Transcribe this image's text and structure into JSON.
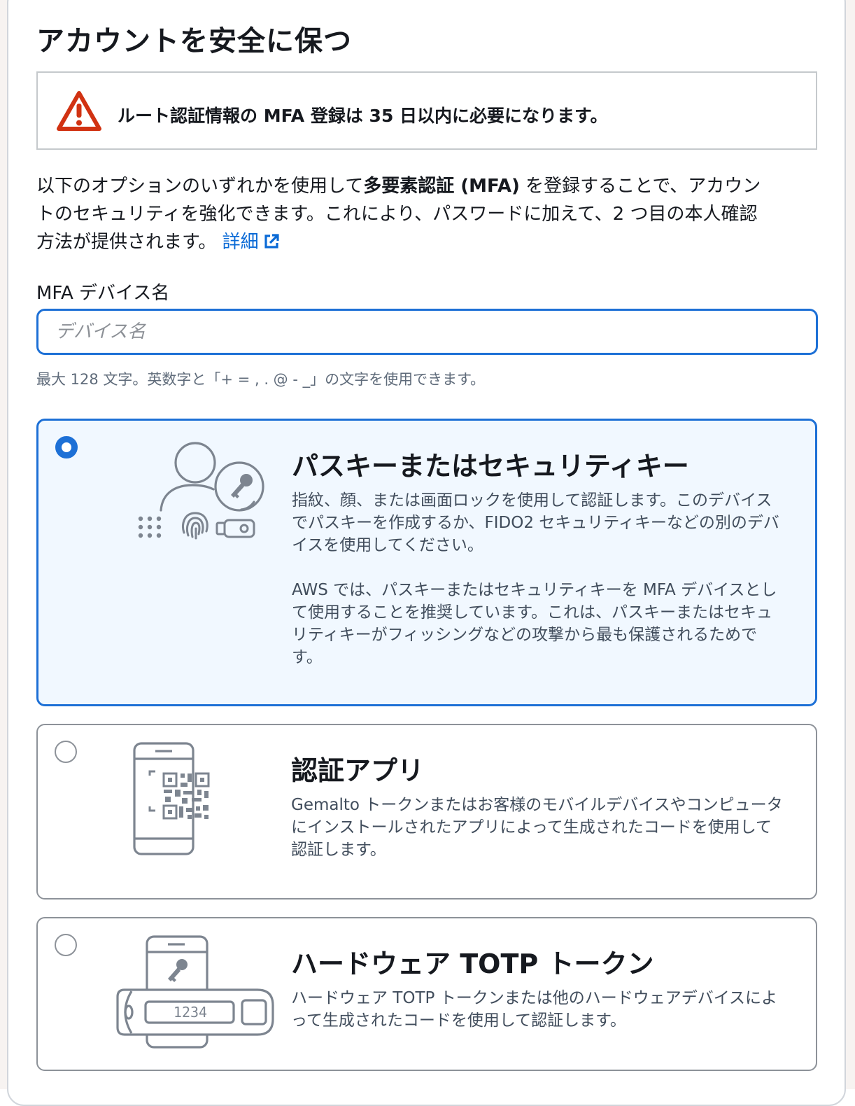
{
  "page": {
    "title": "アカウントを安全に保つ"
  },
  "alert": {
    "icon": "warning-triangle-icon",
    "text": "ルート認証情報の MFA 登録は 35 日以内に必要になります。",
    "color": "#d13212"
  },
  "intro": {
    "line1_pre": "以下のオプションのいずれかを使用して",
    "line1_bold": "多要素認証 (MFA)",
    "line1_post": " を登録することで、アカウン",
    "line2": "トのセキュリティを強化できます。これにより、パスワードに加えて、2 つ目の本人確認",
    "line3": "方法が提供されます。",
    "link_label": "詳細",
    "link_icon": "external-link-icon"
  },
  "mfa_field": {
    "label": "MFA デバイス名",
    "value": "",
    "placeholder": "デバイス名",
    "hint": "最大 128 文字。英数字と「+ = , . @ - _」の文字を使用できます。"
  },
  "options": [
    {
      "selected": true,
      "icon": "passkey-security-key-icon",
      "title": "パスキーまたはセキュリティキー",
      "desc1": [
        "指紋、顔、または画面ロックを使用して認証します。このデバイス",
        "でパスキーを作成するか、FIDO2 セキュリティキーなどの別のデバ",
        "イスを使用してください。"
      ],
      "desc2": [
        "AWS では、パスキーまたはセキュリティキーを MFA デバイスとし",
        "て使用することを推奨しています。これは、パスキーまたはセキュ",
        "リティキーがフィッシングなどの攻撃から最も保護されるためで",
        "す。"
      ]
    },
    {
      "selected": false,
      "icon": "authenticator-app-qr-icon",
      "title": "認証アプリ",
      "desc1": [
        "Gemalto トークンまたはお客様のモバイルデバイスやコンピュータ",
        "にインストールされたアプリによって生成されたコードを使用して",
        "認証します。"
      ]
    },
    {
      "selected": false,
      "icon": "hardware-totp-token-icon",
      "title": "ハードウェア TOTP トークン",
      "token_digits": "1234",
      "desc1": [
        "ハードウェア TOTP トークンまたは他のハードウェアデバイスによ",
        "って生成されたコードを使用して認証します。"
      ]
    }
  ],
  "colors": {
    "accent": "#1d70d6",
    "selected_bg": "#f1f8ff",
    "link": "#0a6ad6",
    "warning": "#d13212",
    "icon_gray": "#7d8590"
  }
}
